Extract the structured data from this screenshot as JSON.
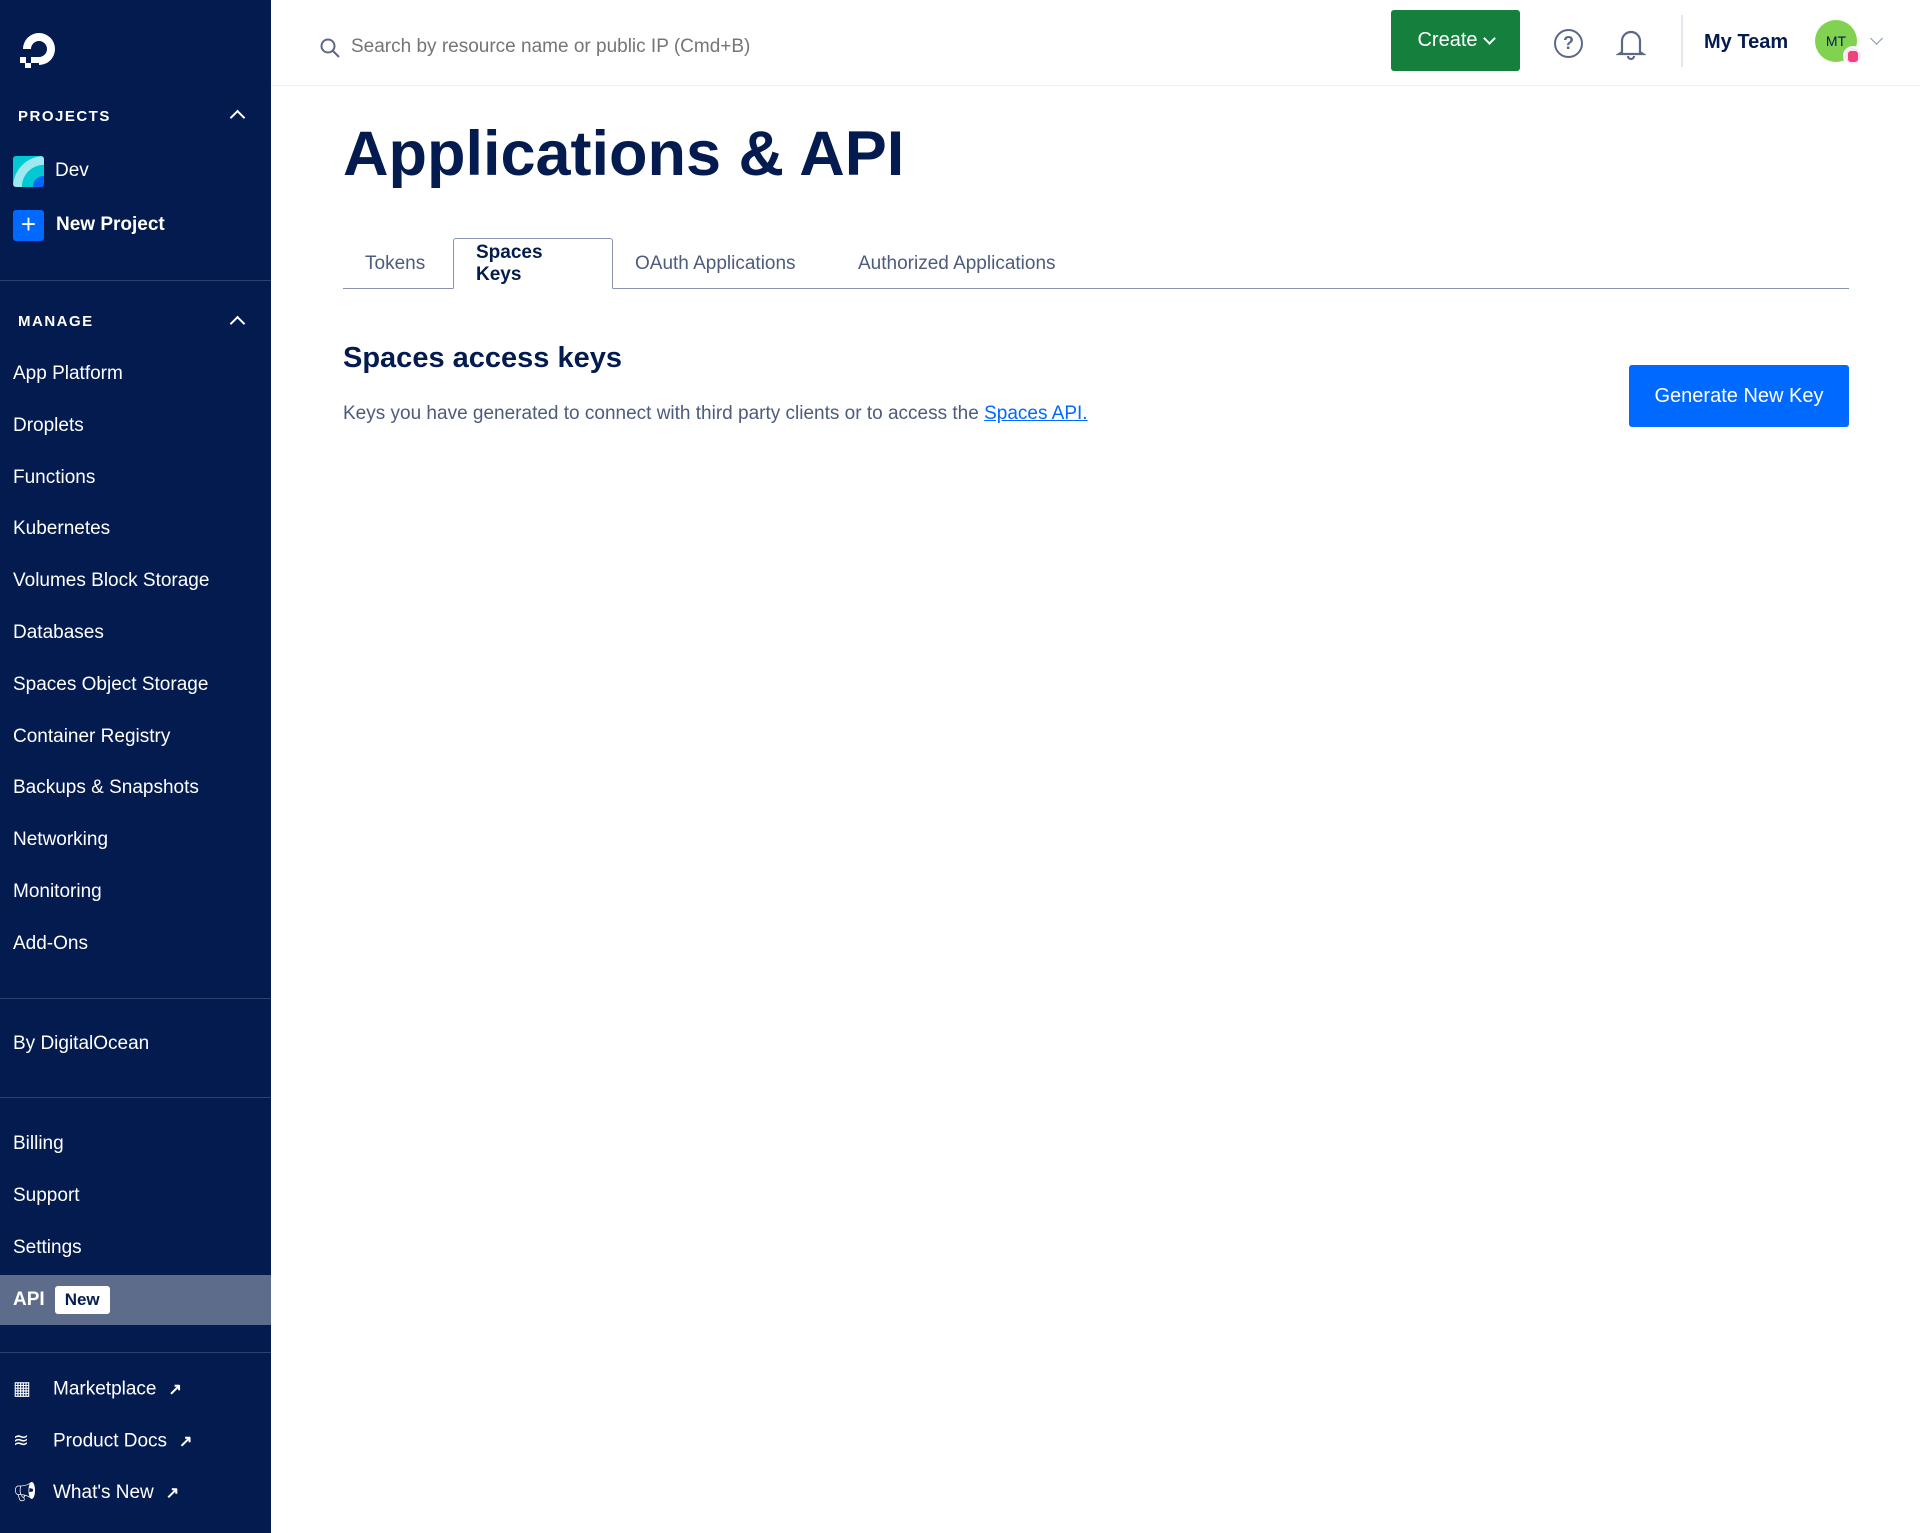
{
  "header": {
    "search_placeholder": "Search by resource name or public IP (Cmd+B)",
    "create_label": "Create",
    "team_name": "My Team",
    "avatar_initials": "MT"
  },
  "sidebar": {
    "projects_heading": "PROJECTS",
    "projects": [
      {
        "label": "Dev"
      },
      {
        "label": "New Project"
      }
    ],
    "manage_heading": "MANAGE",
    "manage_items": [
      "App Platform",
      "Droplets",
      "Functions",
      "Kubernetes",
      "Volumes Block Storage",
      "Databases",
      "Spaces Object Storage",
      "Container Registry",
      "Backups & Snapshots",
      "Networking",
      "Monitoring",
      "Add-Ons"
    ],
    "by_do": "By DigitalOcean",
    "account_items": [
      "Billing",
      "Support",
      "Settings"
    ],
    "api": {
      "label": "API",
      "badge": "New",
      "active": true
    },
    "external": [
      {
        "label": "Marketplace",
        "icon": "box-icon"
      },
      {
        "label": "Product Docs",
        "icon": "layers-icon"
      },
      {
        "label": "What's New",
        "icon": "megaphone-icon"
      }
    ]
  },
  "main": {
    "title": "Applications & API",
    "tabs": [
      {
        "label": "Tokens"
      },
      {
        "label": "Spaces Keys",
        "active": true
      },
      {
        "label": "OAuth Applications"
      },
      {
        "label": "Authorized Applications"
      }
    ],
    "section_title": "Spaces access keys",
    "description": "Keys you have generated to connect with third party clients or to access the ",
    "description_link": "Spaces API.",
    "generate_button": "Generate New Key"
  },
  "colors": {
    "sidebar": "#031b4e",
    "create": "#15803d",
    "primary": "#0069ff",
    "link": "#0069ff"
  }
}
